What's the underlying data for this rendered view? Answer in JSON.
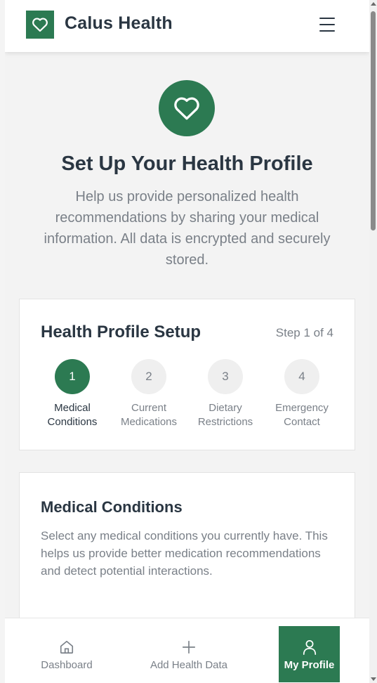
{
  "header": {
    "brand": "Calus Health",
    "logo_icon": "heart-icon",
    "menu_icon": "hamburger-menu-icon"
  },
  "hero": {
    "icon": "heart-icon",
    "title": "Set Up Your Health Profile",
    "subtitle": "Help us provide personalized health recommendations by sharing your medical information. All data is encrypted and securely stored."
  },
  "setup": {
    "title": "Health Profile Setup",
    "step_indicator": "Step 1 of 4",
    "current_step": 1,
    "steps": [
      {
        "number": "1",
        "line1": "Medical",
        "line2": "Conditions"
      },
      {
        "number": "2",
        "line1": "Current",
        "line2": "Medications"
      },
      {
        "number": "3",
        "line1": "Dietary",
        "line2": "Restrictions"
      },
      {
        "number": "4",
        "line1": "Emergency",
        "line2": "Contact"
      }
    ]
  },
  "conditions": {
    "title": "Medical Conditions",
    "description": "Select any medical conditions you currently have. This helps us provide better medication recommendations and detect potential interactions."
  },
  "bottom_nav": {
    "items": [
      {
        "label": "Dashboard",
        "icon": "home-icon"
      },
      {
        "label": "Add Health Data",
        "icon": "plus-icon"
      },
      {
        "label": "My Profile",
        "icon": "user-icon"
      }
    ],
    "active": "My Profile"
  },
  "colors": {
    "brand_green": "#2c7a52",
    "text_dark": "#2a3642",
    "text_muted": "#7a8088"
  }
}
